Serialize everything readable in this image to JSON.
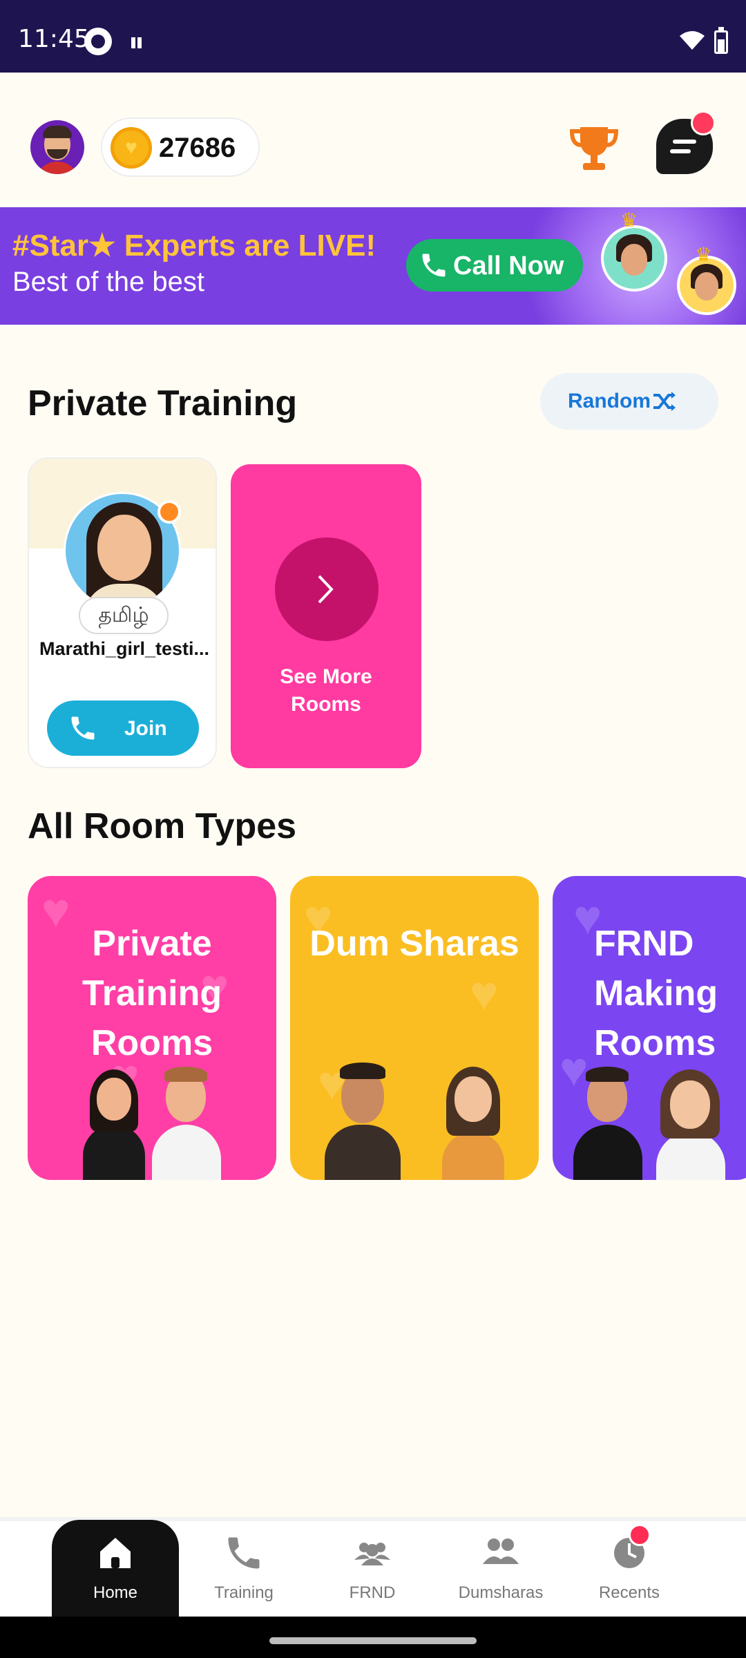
{
  "status_bar": {
    "time": "11:45"
  },
  "header": {
    "coin_balance": "27686"
  },
  "banner": {
    "title": "#Star★ Experts are LIVE!",
    "subtitle": "Best of the best",
    "cta": "Call Now"
  },
  "private_training": {
    "title": "Private Training",
    "random_label": "Random",
    "room": {
      "language": "தமிழ்",
      "host_name": "Marathi_girl_testi...",
      "join_label": "Join"
    },
    "see_more_label": "See More Rooms"
  },
  "room_types": {
    "title": "All Room Types",
    "cards": [
      {
        "title": "Private Training Rooms",
        "color": "#FF3FA6"
      },
      {
        "title": "Dum Sharas",
        "color": "#FBBE22"
      },
      {
        "title": "FRND Making Rooms",
        "color": "#7C45F2"
      }
    ]
  },
  "bottom_nav": {
    "items": [
      {
        "label": "Home",
        "icon": "home-icon",
        "active": true
      },
      {
        "label": "Training",
        "icon": "phone-icon"
      },
      {
        "label": "FRND",
        "icon": "friends-icon"
      },
      {
        "label": "Dumsharas",
        "icon": "group-icon"
      },
      {
        "label": "Recents",
        "icon": "clock-icon"
      }
    ]
  },
  "colors": {
    "accent_pink": "#FF3AA0",
    "join_blue": "#1BAFD8",
    "status_bar": "#1E1550",
    "notification_dot": "#FF2D55"
  }
}
